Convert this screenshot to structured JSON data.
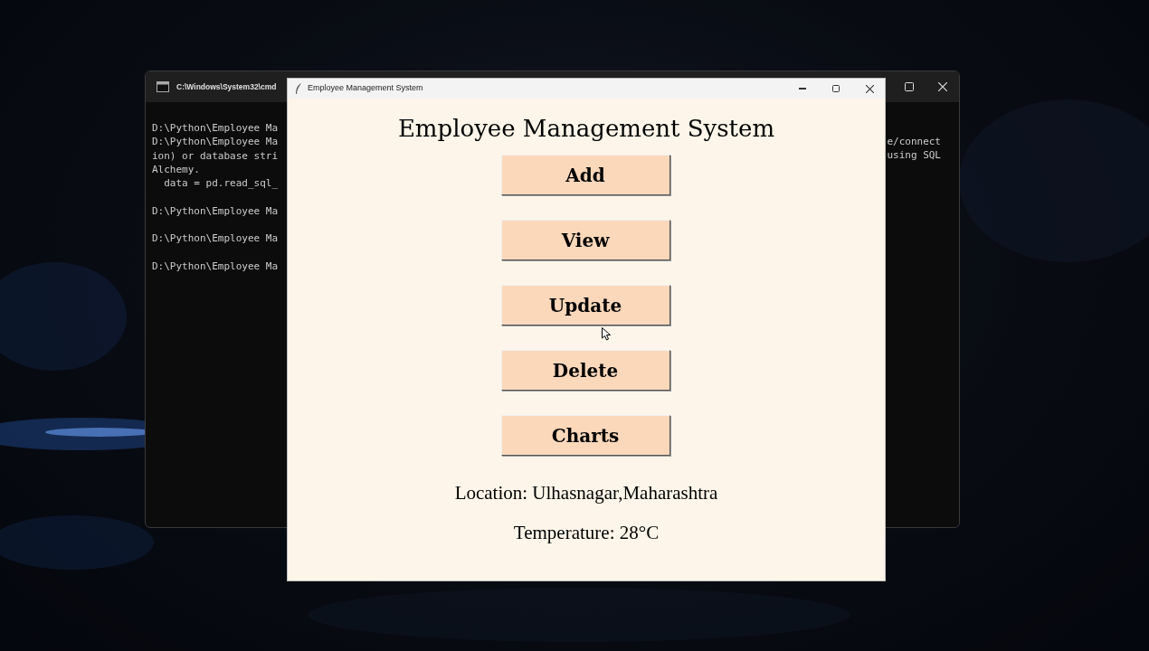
{
  "console_window": {
    "title": "C:\\Windows\\System32\\cmd",
    "lines": [
      [
        "D:\\Python\\Employee Ma",
        "D:\\Python\\Employee Ma",
        "ion) or database stri",
        "Alchemy.",
        "  data = pd.read_sql_"
      ],
      [
        "D:\\Python\\Employee Ma"
      ],
      [
        "D:\\Python\\Employee Ma"
      ],
      [
        "D:\\Python\\Employee Ma"
      ]
    ],
    "right_lines": [
      "e/connect",
      "using SQL"
    ]
  },
  "app_window": {
    "title": "Employee Management System",
    "heading": "Employee Management System",
    "buttons": [
      "Add",
      "View",
      "Update",
      "Delete",
      "Charts"
    ],
    "location": "Location: Ulhasnagar,Maharashtra",
    "temperature": "Temperature: 28°C"
  }
}
